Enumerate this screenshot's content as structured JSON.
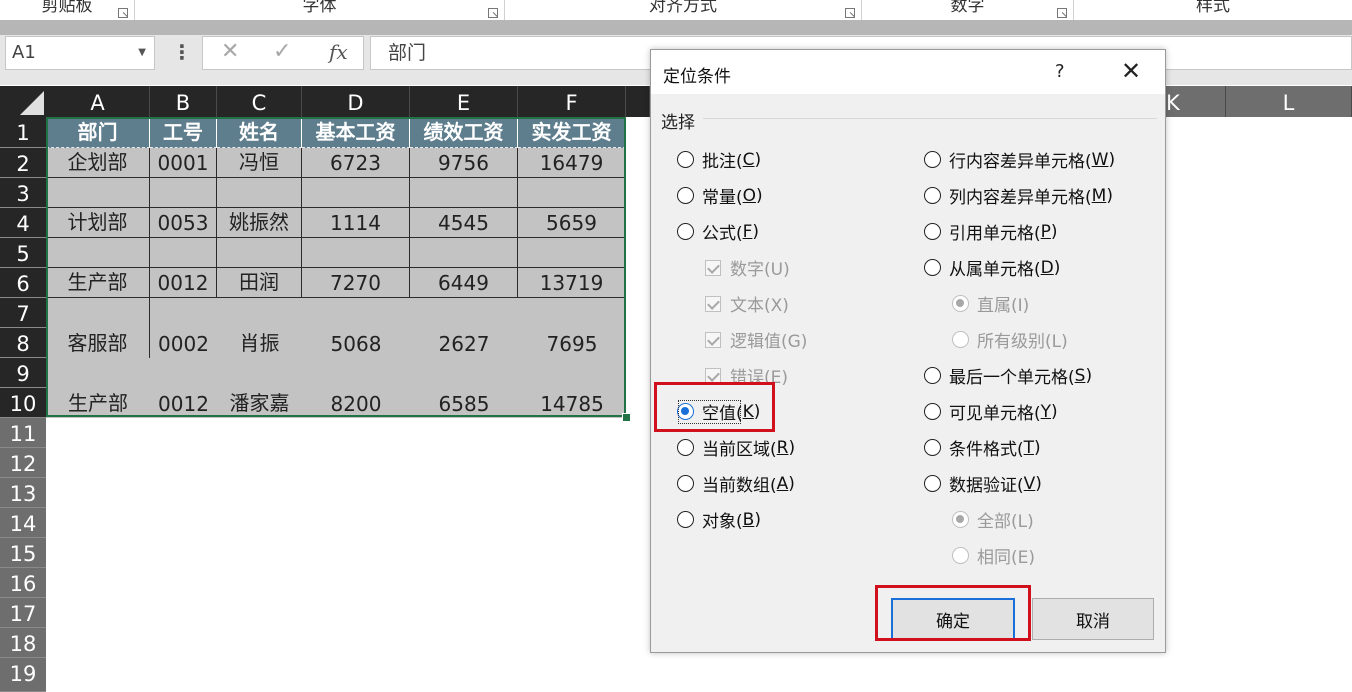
{
  "ribbon": {
    "groups": [
      "剪贴板",
      "字体",
      "对齐方式",
      "数字",
      "样式"
    ]
  },
  "formula_bar": {
    "name_box": "A1",
    "cancel_glyph": "✕",
    "enter_glyph": "✓",
    "fx_label": "fx",
    "formula_value": "部门"
  },
  "sheet": {
    "columns": [
      "A",
      "B",
      "C",
      "D",
      "E",
      "F",
      "K",
      "L"
    ],
    "rows": [
      "1",
      "2",
      "3",
      "4",
      "5",
      "6",
      "7",
      "8",
      "9",
      "10",
      "11",
      "12",
      "13",
      "14",
      "15",
      "16",
      "17",
      "18",
      "19"
    ],
    "header_cells": [
      "部门",
      "工号",
      "姓名",
      "基本工资",
      "绩效工资",
      "实发工资"
    ],
    "data_rows": [
      [
        "企划部",
        "0001",
        "冯恒",
        "6723",
        "9756",
        "16479"
      ],
      [
        "计划部",
        "0053",
        "姚振然",
        "1114",
        "4545",
        "5659"
      ],
      [
        "生产部",
        "0012",
        "田润",
        "7270",
        "6449",
        "13719"
      ],
      [
        "客服部",
        "0002",
        "肖振",
        "5068",
        "2627",
        "7695"
      ],
      [
        "生产部",
        "0012",
        "潘家嘉",
        "8200",
        "6585",
        "14785"
      ]
    ],
    "colors": {
      "header_fill": "#5e7e8e",
      "cell_fill": "#c3c3c3",
      "selection": "#217346"
    }
  },
  "dialog": {
    "title": "定位条件",
    "help": "?",
    "close": "✕",
    "section_label": "选择",
    "left_options": [
      {
        "text": "批注(",
        "key": "C",
        "tail": ")"
      },
      {
        "text": "常量(",
        "key": "O",
        "tail": ")"
      },
      {
        "text": "公式(",
        "key": "F",
        "tail": ")"
      },
      {
        "text": "数字(U)"
      },
      {
        "text": "文本(X)"
      },
      {
        "text": "逻辑值(G)"
      },
      {
        "text": "错误(E)"
      },
      {
        "text": "空值(",
        "key": "K",
        "tail": ")"
      },
      {
        "text": "当前区域(",
        "key": "R",
        "tail": ")"
      },
      {
        "text": "当前数组(",
        "key": "A",
        "tail": ")"
      },
      {
        "text": "对象(",
        "key": "B",
        "tail": ")"
      }
    ],
    "right_options": [
      {
        "text": "行内容差异单元格(",
        "key": "W",
        "tail": ")"
      },
      {
        "text": "列内容差异单元格(",
        "key": "M",
        "tail": ")"
      },
      {
        "text": "引用单元格(",
        "key": "P",
        "tail": ")"
      },
      {
        "text": "从属单元格(",
        "key": "D",
        "tail": ")"
      },
      {
        "text": "直属(I)"
      },
      {
        "text": "所有级别(L)"
      },
      {
        "text": "最后一个单元格(",
        "key": "S",
        "tail": ")"
      },
      {
        "text": "可见单元格(",
        "key": "Y",
        "tail": ")"
      },
      {
        "text": "条件格式(",
        "key": "T",
        "tail": ")"
      },
      {
        "text": "数据验证(",
        "key": "V",
        "tail": ")"
      },
      {
        "text": "全部(L)"
      },
      {
        "text": "相同(E)"
      }
    ],
    "selected_option": "空值(K)",
    "ok_label": "确定",
    "cancel_label": "取消",
    "colors": {
      "accent": "#1a6fd8",
      "highlight_box": "#d0101c"
    }
  }
}
